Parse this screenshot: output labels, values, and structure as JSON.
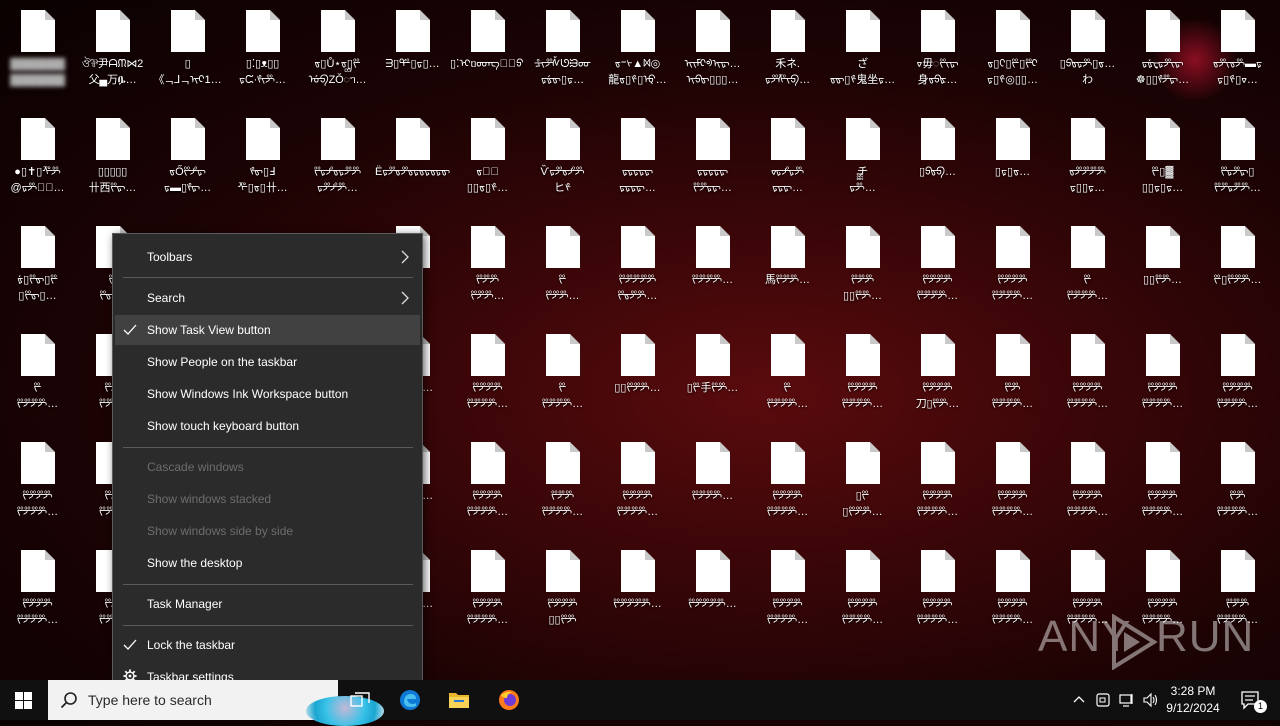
{
  "desktop_icon_labels": [
    [
      "▓▓▓▓▓▓▓\n▓▓▓▓▓▓▓",
      "ঔ⅌尹ᗩᙏ⋈2\n父▄万ᎆ…",
      "▯\n《ᆨ⅃ᆨᢈᢈ1…",
      "▯⁚▯ᴥ▯▯\nᢑᙅ·ᢞᢈᢟ…",
      "ᢐ▯Ů⋆ᢐ▯ᢟ\nᡠᢒZŎᢅᥐ…",
      "ᗱ▯ᢡ▯ᢑ▯…",
      "▯⁚ᢈᥝᡂᡊ⅌ᢆᢒ…",
      "ᡱᢈᢟᢥᘎᙣᡂ\nᢑᢠᢐ▯ᢑ…",
      "ᢐ⁼ᢣ▲ᢂ◎\n龍ᢐ▯ᢞ▯ᡇ…",
      "ᢈᢈᡏᢈᢀᢈᢑ…\nᢈᢒᢐ▯▯▯…",
      "禾ネ.\nᢑᢟᢝᢈᢒ…",
      "ざ\nᢐᢐ▯ᢞ鬼坐ᢑ…",
      "ᢦ毋ᢆᢟᢈᢑ\n身ᢐᢒᢘ…",
      "ᢐ▯ᢗ▯ᢟ▯ᢟᢈ\nᢑ▯ᢞ◎▯▯…",
      "▯ᢒᢐᢑᢟ▯ᢐ…\nわ",
      "ᢑᢠᢏᢑᢟᢈᢑ\n☸▯▯ᢞᢟᢑ…",
      "ᢐᢟᢈᢐᢟ▬ᢑ\nᢑ▯ᢞ▯ᢦ…"
    ],
    [
      "●▯✝▯ᢝᢟ\n@ᢑᢟ▯ᢆ…",
      "▯▯▯▯▯\n卄西ᢟᢑ…",
      "ᢐŐᢟᢞᢑ\nᢑ▬▯ᢞᢑ…",
      "ᢞᢐ▯Ⅎ\nᢝ▯ᢐ▯卄…",
      "ᢟᢑᢞᢐᢑᢟᢟ\nᢑᢟᢞᢟ…",
      "ЁᢑᢟᢐᢟᢐᢑᢐᢑᢐᢑᢐΗ…",
      "ᢐ▯ᢆ\n▯▯ᢐ▯ᢞ…",
      "Ѷᢑᢟᢐᢞᢟ\nヒᢞ",
      "ᢑᢑᢑᢑᢑ\nᢑᢑᢑᢑ…",
      "ᢑᢑᢑᢑᢑ\nᢟᢟᢑᢑ…",
      "ᢦᢑᢞᢑᢟ\nᢑᢑᢑ…",
      "チ\nᢑᢟᢆ…",
      "▯ᢒᢐᢒ…",
      "▯ᢑ▯ᢐ…",
      "ᢐᢟᢟᢟᢟ\nᢑ▯▯ᢑ…",
      "ᢟ▯▓\n▯▯ᢑ▯ᢑ…",
      "ᢟᢑᢟᢑ▯\nᢟᢟᢑᢟᢟ…"
    ],
    [
      "ᢠ▯ᢟᢐ▯ᢟ\n▯ᢟᢐ▯…",
      "ᢟ\nᢟᢐ…",
      "",
      "",
      "",
      "",
      "ᢟᢟᢟ\nᢟᢟᢟ…",
      "ᢟ\nᢟᢟᢟ…",
      "ᢟᢟᢟᢟᢟ\nᢟᢐᢟᢟ…",
      "ᢟᢟᢟᢟ…",
      "馬ᢟᢟᢟ…",
      "ᢟᢟᢟ\n▯▯ᢟᢟ…",
      "ᢟᢟᢟᢟ\nᢟᢟᢟᢟ…",
      "ᢟᢟᢟᢟ\nᢟᢟᢟᢟ…",
      "ᢟ\nᢟᢟᢟᢟ…",
      "▯▯ᢟᢟ…",
      "ᢟ▯ᢟᢟᢟ…"
    ],
    [
      "ᢟ\nᢟᢟᢟᢟ…",
      "ᢟᢟ\nᢟᢟ…",
      "",
      "",
      "",
      "ᢟᢟᢟᢟ…",
      "ᢟᢟᢟᢟ\nᢟᢟᢟᢟ…",
      "ᢟ\nᢟᢟᢟᢟ…",
      "▯▯ᢟᢟᢟ…",
      "▯ᢟ手ᢟᢟ…",
      "ᢟ\nᢟᢟᢟᢟ…",
      "ᢟᢟᢟᢟ\nᢟᢟᢟᢟ…",
      "ᢟᢟᢟᢟ\n刀▯ᢟᢟ…",
      "ᢟᢟ\nᢟᢟᢟᢟ…",
      "ᢟᢟᢟᢟ\nᢟᢟᢟᢟ…",
      "ᢟᢟᢟᢟ\nᢟᢟᢟᢟ…",
      "ᢟᢟᢟᢟ\nᢟᢟᢟᢟ…"
    ],
    [
      "ᢟᢟᢟᢟ\nᢟᢟᢟᢟ…",
      "ᢟᢟ\nᢟᢟ…",
      "",
      "",
      "",
      "ᢟᢟᢟᢟ…",
      "ᢟᢟᢟᢟ\nᢟᢟᢟᢟ…",
      "ᢟᢟᢟ\nᢟᢟᢟᢟ…",
      "ᢟᢟᢟᢟ\nᢟᢟᢟᢟ…",
      "ᢟᢟᢟᢟ…",
      "ᢟᢟᢟᢟ\nᢟᢟᢟᢟ…",
      "▯ᢟ\n▯ᢟᢟᢟ…",
      "ᢟᢟᢟᢟ\nᢟᢟᢟᢟ…",
      "ᢟᢟᢟᢟ\nᢟᢟᢟᢟ…",
      "ᢟᢟᢟᢟ\nᢟᢟᢟᢟ…",
      "ᢟᢟᢟᢟ\nᢟᢟᢟᢟ…",
      "ᢟᢟ\nᢟᢟᢟᢟ…"
    ],
    [
      "ᢟᢟᢟᢟ\nᢟᢟᢟᢟ…",
      "ᢟᢟ\nᢟᢟ…",
      "",
      "",
      "",
      "ᢟᢟᢟᢟ…",
      "ᢟᢟᢟᢟ\nᢟᢟᢟᢟ…",
      "ᢟᢟᢟᢟ\n▯▯ᢟᢟ",
      "ᢟᢟᢟᢟᢟ…",
      "ᢟᢟᢟᢟᢟ…",
      "ᢟᢟᢟᢟ\nᢟᢟᢟᢟ…",
      "ᢟᢟᢟᢟ\nᢟᢟᢟᢟ…",
      "ᢟᢟᢟᢟ\nᢟᢟᢟᢟ…",
      "ᢟᢟᢟᢟ\nᢟᢟᢟᢟ…",
      "ᢟᢟᢟᢟ\nᢟᢟᢟᢟ…",
      "ᢟᢟᢟᢟ\nᢟᢟᢟᢟ…",
      "ᢟᢟᢟ\nᢟᢟᢟᢟ…"
    ]
  ],
  "context_menu": {
    "items": [
      {
        "label": "Toolbars",
        "submenu": true,
        "checked": false,
        "disabled": false
      },
      {
        "label": "Search",
        "submenu": true,
        "checked": false,
        "disabled": false
      },
      {
        "label": "Show Task View button",
        "submenu": false,
        "checked": true,
        "disabled": false,
        "highlighted": true
      },
      {
        "label": "Show People on the taskbar",
        "submenu": false,
        "checked": false,
        "disabled": false
      },
      {
        "label": "Show Windows Ink Workspace button",
        "submenu": false,
        "checked": false,
        "disabled": false
      },
      {
        "label": "Show touch keyboard button",
        "submenu": false,
        "checked": false,
        "disabled": false
      },
      {
        "label": "Cascade windows",
        "submenu": false,
        "checked": false,
        "disabled": true
      },
      {
        "label": "Show windows stacked",
        "submenu": false,
        "checked": false,
        "disabled": true
      },
      {
        "label": "Show windows side by side",
        "submenu": false,
        "checked": false,
        "disabled": true
      },
      {
        "label": "Show the desktop",
        "submenu": false,
        "checked": false,
        "disabled": false
      },
      {
        "label": "Task Manager",
        "submenu": false,
        "checked": false,
        "disabled": false
      },
      {
        "label": "Lock the taskbar",
        "submenu": false,
        "checked": true,
        "disabled": false
      },
      {
        "label": "Taskbar settings",
        "submenu": false,
        "checked": false,
        "disabled": false,
        "icon": "gear-icon"
      }
    ]
  },
  "taskbar": {
    "search_placeholder": "Type here to search",
    "pinned_apps": [
      "task-view-icon",
      "edge-icon",
      "file-explorer-icon",
      "firefox-icon"
    ],
    "tray_icons": [
      "chevron-up-icon",
      "meet-now-icon",
      "network-icon",
      "volume-icon"
    ],
    "time": "3:28 PM",
    "date": "9/12/2024",
    "notification_count": "1"
  },
  "watermark": {
    "text_left": "ANY",
    "text_right": "RUN"
  },
  "colors": {
    "menu_bg": "#2b2b2b",
    "menu_hover": "#414141",
    "menu_disabled": "#6d6d6d",
    "taskbar_bg": "#101010",
    "accent": "#0078d7"
  }
}
